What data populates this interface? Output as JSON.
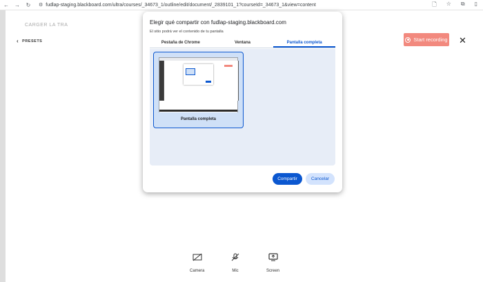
{
  "browser": {
    "back_icon": "back-arrow-icon",
    "forward_icon": "forward-arrow-icon",
    "reload_icon": "reload-icon",
    "url": "fudlap-staging.blackboard.com/ultra/courses/_34673_1/outline/edit/document/_2839101_1?courseId=_34673_1&view=content"
  },
  "background_page": {
    "faded_title": "CARGER LA TRA",
    "presets_label": "PRESETS",
    "start_recording_label": "Start recording",
    "controls": {
      "camera_label": "Camera",
      "mic_label": "Mic",
      "screen_label": "Screen"
    }
  },
  "dialog": {
    "title": "Elegir qué compartir con fudlap-staging.blackboard.com",
    "subtitle": "El sitio podrá ver el contenido de tu pantalla",
    "tabs": [
      {
        "label": "Pestaña de Chrome",
        "active": false
      },
      {
        "label": "Ventana",
        "active": false
      },
      {
        "label": "Pantalla completa",
        "active": true
      }
    ],
    "source_tile_label": "Pantalla completa",
    "share_label": "Compartir",
    "cancel_label": "Cancelar"
  },
  "colors": {
    "accent": "#0b57d0",
    "record_button": "#f2897e",
    "panel_bg": "#e7edf7"
  }
}
